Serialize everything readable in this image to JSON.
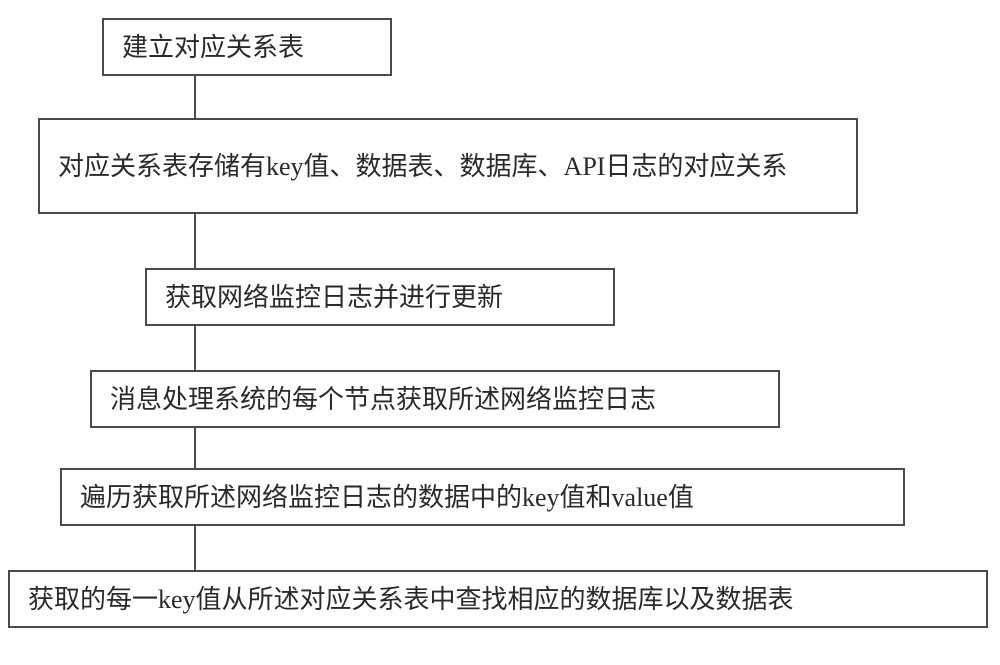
{
  "flowchart": {
    "nodes": [
      {
        "id": "step1",
        "text": "建立对应关系表"
      },
      {
        "id": "step2",
        "text": "对应关系表存储有key值、数据表、数据库、API日志的对应关系"
      },
      {
        "id": "step3",
        "text": "获取网络监控日志并进行更新"
      },
      {
        "id": "step4",
        "text": "消息处理系统的每个节点获取所述网络监控日志"
      },
      {
        "id": "step5",
        "text": "遍历获取所述网络监控日志的数据中的key值和value值"
      },
      {
        "id": "step6",
        "text": "获取的每一key值从所述对应关系表中查找相应的数据库以及数据表"
      }
    ]
  }
}
